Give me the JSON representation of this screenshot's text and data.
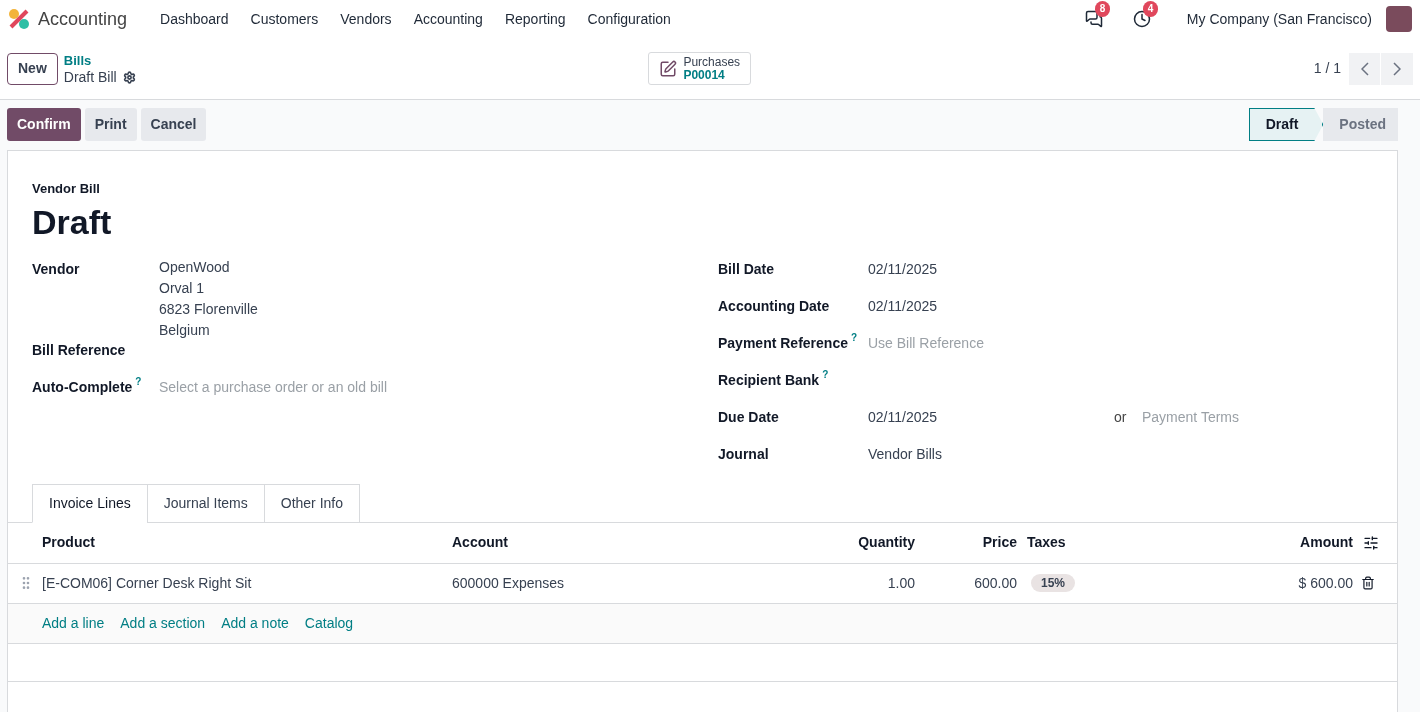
{
  "navbar": {
    "app": "Accounting",
    "menu": [
      "Dashboard",
      "Customers",
      "Vendors",
      "Accounting",
      "Reporting",
      "Configuration"
    ],
    "messages_count": "8",
    "activities_count": "4",
    "company": "My Company (San Francisco)"
  },
  "control_panel": {
    "new_button": "New",
    "breadcrumb": "Bills",
    "record": "Draft Bill",
    "smart_button": {
      "label": "Purchases",
      "value": "P00014"
    },
    "pager": "1 / 1"
  },
  "actions": [
    {
      "label": "Confirm",
      "primary": true
    },
    {
      "label": "Print",
      "primary": false
    },
    {
      "label": "Cancel",
      "primary": false
    }
  ],
  "status": [
    {
      "label": "Draft",
      "selected": true
    },
    {
      "label": "Posted",
      "selected": false
    }
  ],
  "form": {
    "type_label": "Vendor Bill",
    "title": "Draft",
    "left_fields": [
      {
        "label": "Vendor",
        "kind": "address",
        "lines": [
          "OpenWood",
          "Orval 1",
          "6823 Florenville",
          "Belgium"
        ]
      },
      {
        "label": "Bill Reference",
        "kind": "empty"
      },
      {
        "label": "Auto-Complete",
        "help": "?",
        "kind": "placeholder",
        "placeholder": "Select a purchase order or an old bill"
      }
    ],
    "right_fields": [
      {
        "label": "Bill Date",
        "kind": "text",
        "value": "02/11/2025"
      },
      {
        "label": "Accounting Date",
        "kind": "text",
        "value": "02/11/2025"
      },
      {
        "label": "Payment Reference",
        "help": "?",
        "kind": "placeholder",
        "placeholder": "Use Bill Reference"
      },
      {
        "label": "Recipient Bank",
        "help": "?",
        "kind": "empty"
      },
      {
        "label": "Due Date",
        "kind": "due",
        "value": "02/11/2025",
        "or": "or",
        "placeholder": "Payment Terms"
      },
      {
        "label": "Journal",
        "kind": "text",
        "value": "Vendor Bills"
      }
    ]
  },
  "tabs": [
    {
      "label": "Invoice Lines",
      "selected": true
    },
    {
      "label": "Journal Items",
      "selected": false
    },
    {
      "label": "Other Info",
      "selected": false
    }
  ],
  "table": {
    "columns": [
      "Product",
      "Account",
      "Quantity",
      "Price",
      "Taxes",
      "Amount"
    ],
    "rows": [
      {
        "product": "[E-COM06] Corner Desk Right Sit",
        "account": "600000 Expenses",
        "quantity": "1.00",
        "price": "600.00",
        "taxes": [
          "15%"
        ],
        "amount": "$ 600.00"
      }
    ],
    "add_links": [
      "Add a line",
      "Add a section",
      "Add a note",
      "Catalog"
    ]
  }
}
